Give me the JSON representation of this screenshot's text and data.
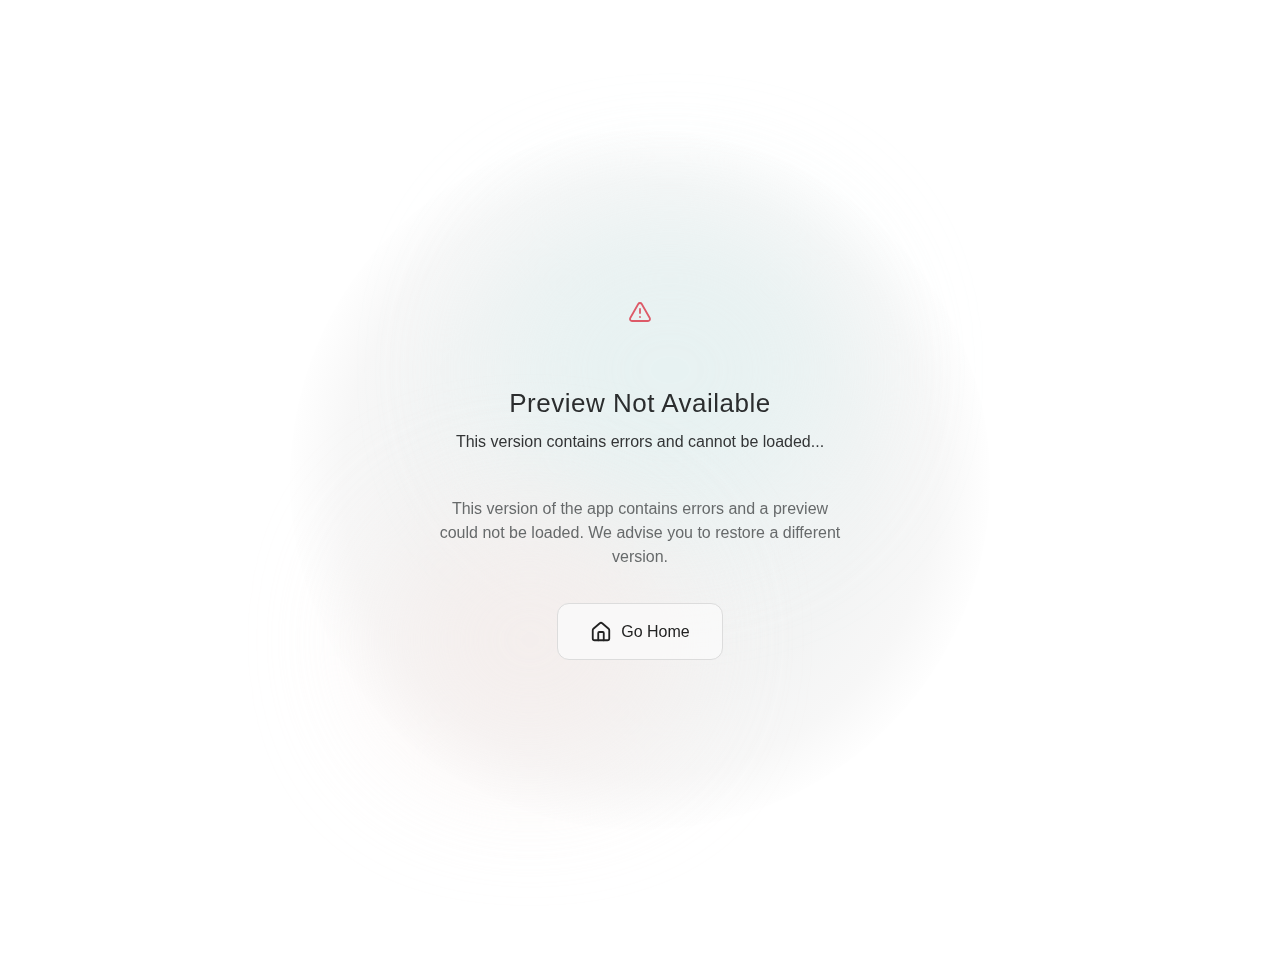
{
  "title": "Preview Not Available",
  "subtitle": "This version contains errors and cannot be loaded...",
  "message": "This version of the app contains errors and a preview could not be loaded. We advise you to restore a different version.",
  "button": {
    "label": "Go Home"
  }
}
